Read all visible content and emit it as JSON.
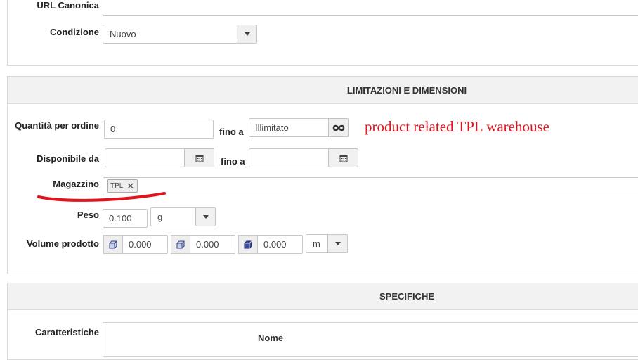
{
  "general": {
    "url_label": "URL Canonica",
    "url_value": "",
    "condition_label": "Condizione",
    "condition_value": "Nuovo"
  },
  "limits": {
    "title": "LIMITAZIONI E DIMENSIONI",
    "qty_label": "Quantità per ordine",
    "qty_value": "0",
    "fino_a": "fino a",
    "qty_max_value": "Illimitato",
    "available_label": "Disponibile da",
    "available_from": "",
    "available_to": "",
    "warehouse_label": "Magazzino",
    "warehouse_tag": "TPL",
    "weight_label": "Peso",
    "weight_value": "0.100",
    "weight_unit": "g",
    "volume_label": "Volume prodotto",
    "volume_values": [
      "0.000",
      "0.000",
      "0.000"
    ],
    "volume_unit": "m"
  },
  "annotation": {
    "text": "product related TPL warehouse",
    "color": "#e0141e"
  },
  "specs": {
    "title": "SPECIFICHE",
    "features_label": "Caratteristiche",
    "name_header": "Nome"
  },
  "icons": {
    "calendar": "calendar-icon",
    "infinity": "infinity-icon",
    "cube": "cube-icon",
    "caret": "caret-down-icon",
    "remove": "close-icon"
  }
}
